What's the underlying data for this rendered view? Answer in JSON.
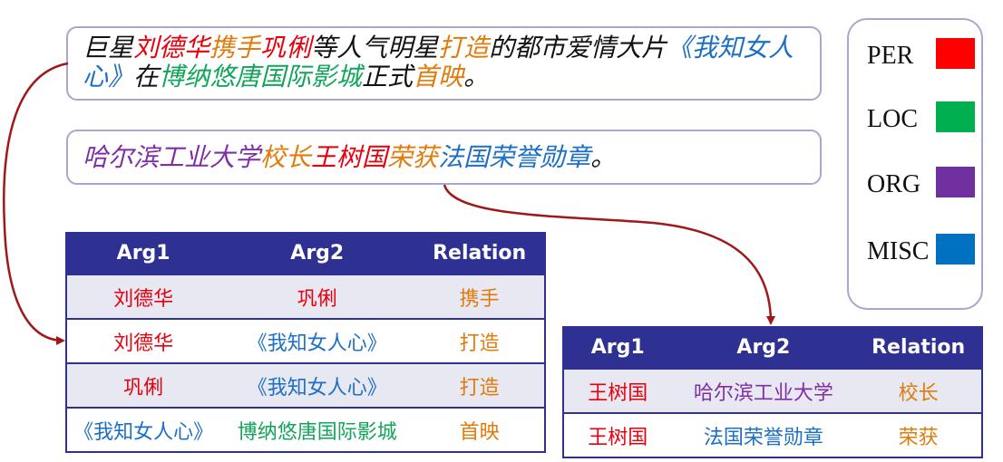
{
  "sentences": [
    {
      "segments": [
        {
          "text": "巨星",
          "type": "plain"
        },
        {
          "text": "刘德华",
          "type": "per"
        },
        {
          "text": "携手",
          "type": "rel"
        },
        {
          "text": "巩俐",
          "type": "per"
        },
        {
          "text": "等人气明星",
          "type": "plain"
        },
        {
          "text": "打造",
          "type": "rel"
        },
        {
          "text": "的都市爱情大片",
          "type": "plain"
        },
        {
          "text": "《我知女人心》",
          "type": "misc"
        },
        {
          "text": "在",
          "type": "plain"
        },
        {
          "text": "博纳悠唐国际影城",
          "type": "loc"
        },
        {
          "text": "正式",
          "type": "plain"
        },
        {
          "text": "首映",
          "type": "rel"
        },
        {
          "text": "。",
          "type": "plain"
        }
      ]
    },
    {
      "segments": [
        {
          "text": "哈尔滨工业大学",
          "type": "org"
        },
        {
          "text": "校长",
          "type": "rel"
        },
        {
          "text": "王树国",
          "type": "per"
        },
        {
          "text": "荣获",
          "type": "rel"
        },
        {
          "text": "法国荣誉勋章",
          "type": "misc"
        },
        {
          "text": "。",
          "type": "plain"
        }
      ]
    }
  ],
  "legend": [
    {
      "label": "PER",
      "color": "#ff0000"
    },
    {
      "label": "LOC",
      "color": "#00b050"
    },
    {
      "label": "ORG",
      "color": "#7030a0"
    },
    {
      "label": "MISC",
      "color": "#0070c0"
    }
  ],
  "colors": {
    "per": "#e8000d",
    "loc": "#13a55a",
    "org": "#7f2fa6",
    "misc": "#1c6fc6",
    "rel": "#e07b0c",
    "table_header": "#2e3192",
    "arrow": "#a01818",
    "box_border": "#a9a6d2"
  },
  "table1": {
    "headers": [
      "Arg1",
      "Arg2",
      "Relation"
    ],
    "rows": [
      [
        {
          "text": "刘德华",
          "type": "per"
        },
        {
          "text": "巩俐",
          "type": "per"
        },
        {
          "text": "携手",
          "type": "rel"
        }
      ],
      [
        {
          "text": "刘德华",
          "type": "per"
        },
        {
          "text": "《我知女人心》",
          "type": "misc"
        },
        {
          "text": "打造",
          "type": "rel"
        }
      ],
      [
        {
          "text": "巩俐",
          "type": "per"
        },
        {
          "text": "《我知女人心》",
          "type": "misc"
        },
        {
          "text": "打造",
          "type": "rel"
        }
      ],
      [
        {
          "text": "《我知女人心》",
          "type": "misc"
        },
        {
          "text": "博纳悠唐国际影城",
          "type": "loc"
        },
        {
          "text": "首映",
          "type": "rel"
        }
      ]
    ]
  },
  "table2": {
    "headers": [
      "Arg1",
      "Arg2",
      "Relation"
    ],
    "rows": [
      [
        {
          "text": "王树国",
          "type": "per"
        },
        {
          "text": "哈尔滨工业大学",
          "type": "org"
        },
        {
          "text": "校长",
          "type": "rel"
        }
      ],
      [
        {
          "text": "王树国",
          "type": "per"
        },
        {
          "text": "法国荣誉勋章",
          "type": "misc"
        },
        {
          "text": "荣获",
          "type": "rel"
        }
      ]
    ]
  }
}
